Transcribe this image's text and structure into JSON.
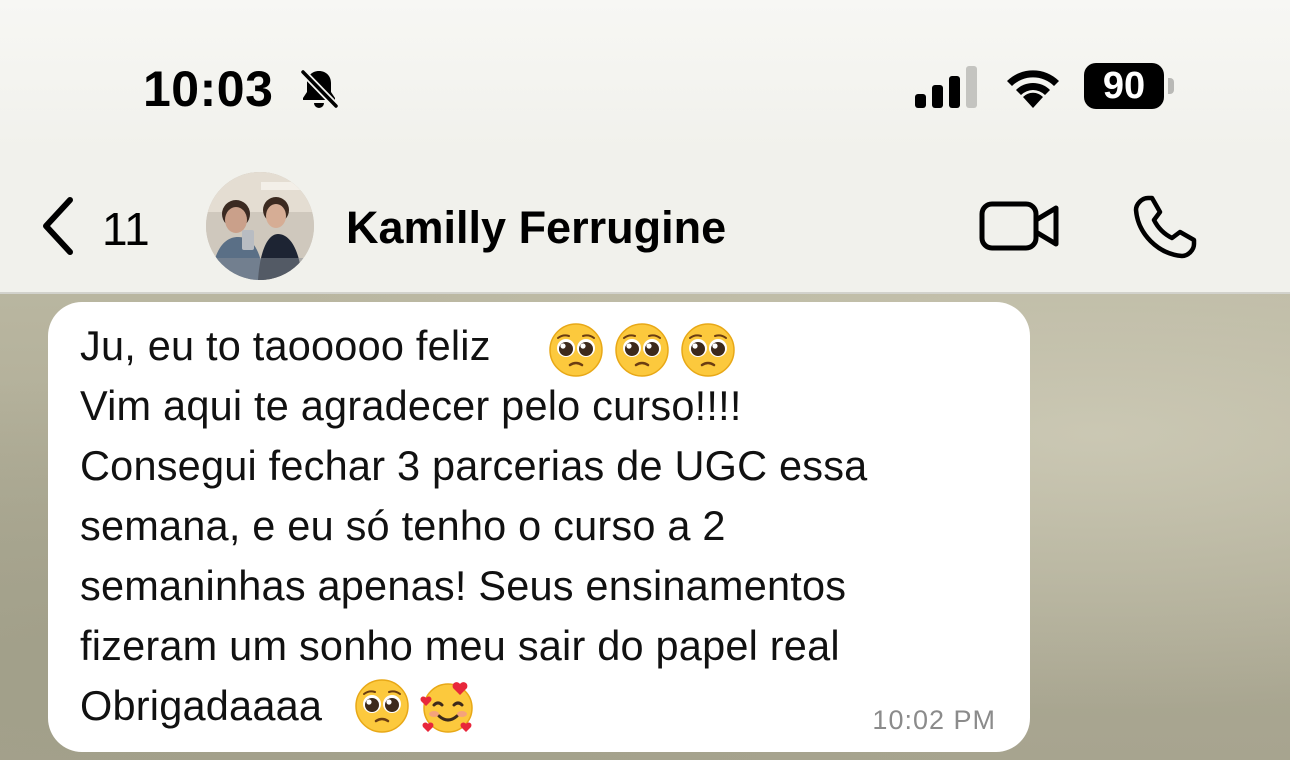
{
  "status_bar": {
    "time": "10:03",
    "battery_level": "90",
    "icons": [
      "bell-muted-icon",
      "signal-icon",
      "wifi-icon",
      "battery-icon"
    ]
  },
  "header": {
    "back_count": "11",
    "contact_name": "Kamilly Ferrugine",
    "icons": [
      "chevron-left-icon",
      "video-call-icon",
      "phone-icon"
    ]
  },
  "message": {
    "lines": [
      "Ju, eu to taooooo feliz",
      "Vim aqui te agradecer pelo curso!!!!",
      "Consegui fechar 3 parcerias de UGC essa",
      "semana, e eu só tenho o curso a 2",
      "semaninhas apenas! Seus ensinamentos",
      "fizeram um sonho meu sair do papel real",
      "Obrigadaaaa"
    ],
    "emojis_line1": [
      "pleading-face",
      "pleading-face",
      "pleading-face"
    ],
    "emojis_last_line": [
      "pleading-face",
      "smiling-face-with-hearts"
    ],
    "time": "10:02 PM"
  },
  "colors": {
    "bubble": "#ffffff",
    "header_bg": "#f1f1ec",
    "timestamp": "#8b8b8b"
  }
}
